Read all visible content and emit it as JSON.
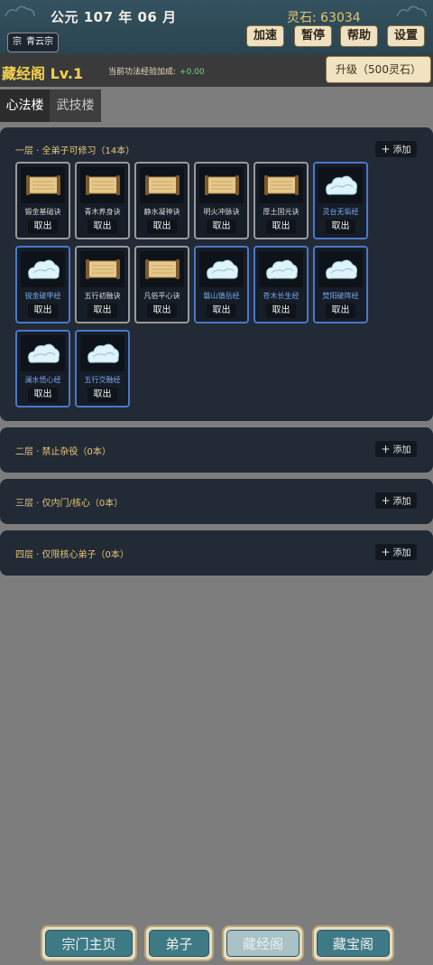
{
  "header": {
    "date": "公元 107 年 06 月",
    "spirit_stones": "灵石: 63034",
    "sect_icon": "宗",
    "sect_name": "青云宗",
    "buttons": {
      "speed": "加速",
      "pause": "暂停",
      "help": "帮助",
      "settings": "设置"
    }
  },
  "title_bar": {
    "name": "藏经阁 Lv.1",
    "exp_label": "当前功法经验加成:",
    "exp_value": "+0.00",
    "upgrade": "升级（500灵石）"
  },
  "tabs": [
    {
      "label": "心法楼",
      "active": true
    },
    {
      "label": "武技楼",
      "active": false
    }
  ],
  "floors": [
    {
      "title": "一层 · 全弟子可修习（14本）",
      "add_label": "添加",
      "books": [
        {
          "name": "锻金基础诀",
          "kind": "scroll",
          "take": "取出"
        },
        {
          "name": "青木养身诀",
          "kind": "scroll",
          "take": "取出"
        },
        {
          "name": "静水凝神诀",
          "kind": "scroll",
          "take": "取出"
        },
        {
          "name": "明火冲脉诀",
          "kind": "scroll",
          "take": "取出"
        },
        {
          "name": "厚土固元诀",
          "kind": "scroll",
          "take": "取出"
        },
        {
          "name": "灵台无垢经",
          "kind": "cloud",
          "take": "取出"
        },
        {
          "name": "锐金破甲经",
          "kind": "cloud",
          "take": "取出"
        },
        {
          "name": "五行初融诀",
          "kind": "scroll",
          "take": "取出"
        },
        {
          "name": "凡俗平心诀",
          "kind": "scroll",
          "take": "取出"
        },
        {
          "name": "磐山镇岳经",
          "kind": "cloud",
          "take": "取出"
        },
        {
          "name": "苍木长生经",
          "kind": "cloud",
          "take": "取出"
        },
        {
          "name": "焚阳破阵经",
          "kind": "cloud",
          "take": "取出"
        },
        {
          "name": "澜水悟心经",
          "kind": "cloud",
          "take": "取出"
        },
        {
          "name": "五行交融经",
          "kind": "cloud",
          "take": "取出"
        }
      ]
    },
    {
      "title": "二层 · 禁止杂役（0本）",
      "add_label": "添加",
      "books": []
    },
    {
      "title": "三层 · 仅内门/核心（0本）",
      "add_label": "添加",
      "books": []
    },
    {
      "title": "四层 · 仅限核心弟子（0本）",
      "add_label": "添加",
      "books": []
    }
  ],
  "bottom_nav": [
    {
      "label": "宗门主页",
      "active": false
    },
    {
      "label": "弟子",
      "active": false
    },
    {
      "label": "藏经阁",
      "active": true
    },
    {
      "label": "藏宝阁",
      "active": false
    }
  ],
  "colors": {
    "header_bg": "#2e4a57",
    "panel_bg": "#222a36",
    "gold_text": "#f4d24e",
    "blue_border": "#4a78c8"
  }
}
